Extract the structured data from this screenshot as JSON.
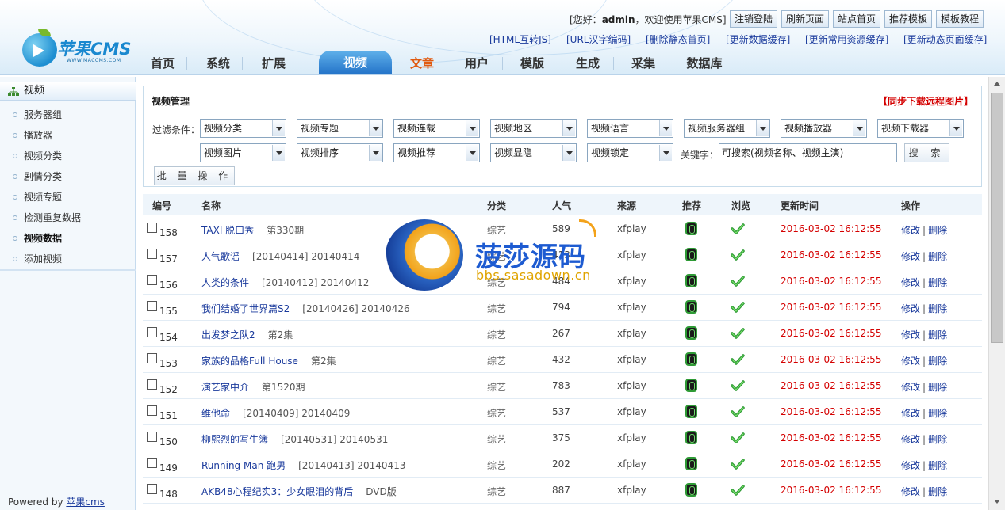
{
  "logo": {
    "text": "苹果CMS",
    "subtext": "WWW.MACCMS.COM"
  },
  "header": {
    "welcome_prefix": "[您好：",
    "user": "admin",
    "welcome_suffix": "，欢迎使用苹果CMS]",
    "buttons": [
      "注销登陆",
      "刷新页面",
      "站点首页",
      "推荐模板",
      "模板教程"
    ],
    "quick_links": [
      "[HTML互转JS]",
      "[URL汉字编码]",
      "[删除静态首页]",
      "[更新数据缓存]",
      "[更新常用资源缓存]",
      "[更新动态页面缓存]"
    ]
  },
  "nav": {
    "items": [
      "首页",
      "系统",
      "扩展",
      "视频",
      "文章",
      "用户",
      "模版",
      "生成",
      "采集",
      "数据库"
    ],
    "active": "视频"
  },
  "sidebar": {
    "title": "视频",
    "items": [
      "服务器组",
      "播放器",
      "视频分类",
      "剧情分类",
      "视频专题",
      "检测重复数据",
      "视频数据",
      "添加视频"
    ],
    "active": "视频数据"
  },
  "footer": {
    "powered_prefix": "Powered by ",
    "powered_link": "苹果cms"
  },
  "panel": {
    "title": "视频管理",
    "sync_link_open": "【",
    "sync_link": "同步下载远程图片",
    "sync_link_close": "】",
    "filter_label": "过滤条件：",
    "filters_row1": [
      "视频分类",
      "视频专题",
      "视频连载",
      "视频地区",
      "视频语言",
      "视频服务器组",
      "视频播放器",
      "视频下载器"
    ],
    "filters_row2": [
      "视频图片",
      "视频排序",
      "视频推荐",
      "视频显隐",
      "视频锁定"
    ],
    "keyword_label": "关键字：",
    "keyword_value": "可搜索(视频名称、视频主演)",
    "search_button": "搜 索",
    "batch_button": "批 量 操 作"
  },
  "table": {
    "columns": [
      "编号",
      "名称",
      "分类",
      "人气",
      "来源",
      "推荐",
      "浏览",
      "更新时间",
      "操作"
    ],
    "rows": [
      {
        "id": "158",
        "name": "TAXI 脱口秀",
        "note": "第330期",
        "category": "综艺",
        "hits": "589",
        "from": "xfplay",
        "time": "2016-03-02 16:12:55"
      },
      {
        "id": "157",
        "name": "人气歌谣",
        "note": "[20140414] 20140414",
        "category": "综艺",
        "hits": "413",
        "from": "xfplay",
        "time": "2016-03-02 16:12:55"
      },
      {
        "id": "156",
        "name": "人类的条件",
        "note": "[20140412] 20140412",
        "category": "综艺",
        "hits": "484",
        "from": "xfplay",
        "time": "2016-03-02 16:12:55"
      },
      {
        "id": "155",
        "name": "我们结婚了世界篇S2",
        "note": "[20140426] 20140426",
        "category": "综艺",
        "hits": "794",
        "from": "xfplay",
        "time": "2016-03-02 16:12:55"
      },
      {
        "id": "154",
        "name": "出发梦之队2",
        "note": "第2集",
        "category": "综艺",
        "hits": "267",
        "from": "xfplay",
        "time": "2016-03-02 16:12:55"
      },
      {
        "id": "153",
        "name": "家族的品格Full House",
        "note": "第2集",
        "category": "综艺",
        "hits": "432",
        "from": "xfplay",
        "time": "2016-03-02 16:12:55"
      },
      {
        "id": "152",
        "name": "演艺家中介",
        "note": "第1520期",
        "category": "综艺",
        "hits": "783",
        "from": "xfplay",
        "time": "2016-03-02 16:12:55"
      },
      {
        "id": "151",
        "name": "维他命",
        "note": "[20140409] 20140409",
        "category": "综艺",
        "hits": "537",
        "from": "xfplay",
        "time": "2016-03-02 16:12:55"
      },
      {
        "id": "150",
        "name": "柳熙烈的写生簿",
        "note": "[20140531] 20140531",
        "category": "综艺",
        "hits": "375",
        "from": "xfplay",
        "time": "2016-03-02 16:12:55"
      },
      {
        "id": "149",
        "name": "Running Man 跑男",
        "note": "[20140413] 20140413",
        "category": "综艺",
        "hits": "202",
        "from": "xfplay",
        "time": "2016-03-02 16:12:55"
      },
      {
        "id": "148",
        "name": "AKB48心程纪实3：少女眼泪的背后",
        "note": "DVD版",
        "category": "综艺",
        "hits": "887",
        "from": "xfplay",
        "time": "2016-03-02 16:12:55"
      }
    ],
    "edit_label": "修改",
    "sep": "|",
    "delete_label": "删除"
  },
  "watermark": {
    "title": "菠莎源码",
    "url": "bbs.sasadown.cn"
  },
  "colors": {
    "accent": "#2171c7",
    "time_red": "#d40000",
    "link_blue": "#1a3a9c"
  }
}
